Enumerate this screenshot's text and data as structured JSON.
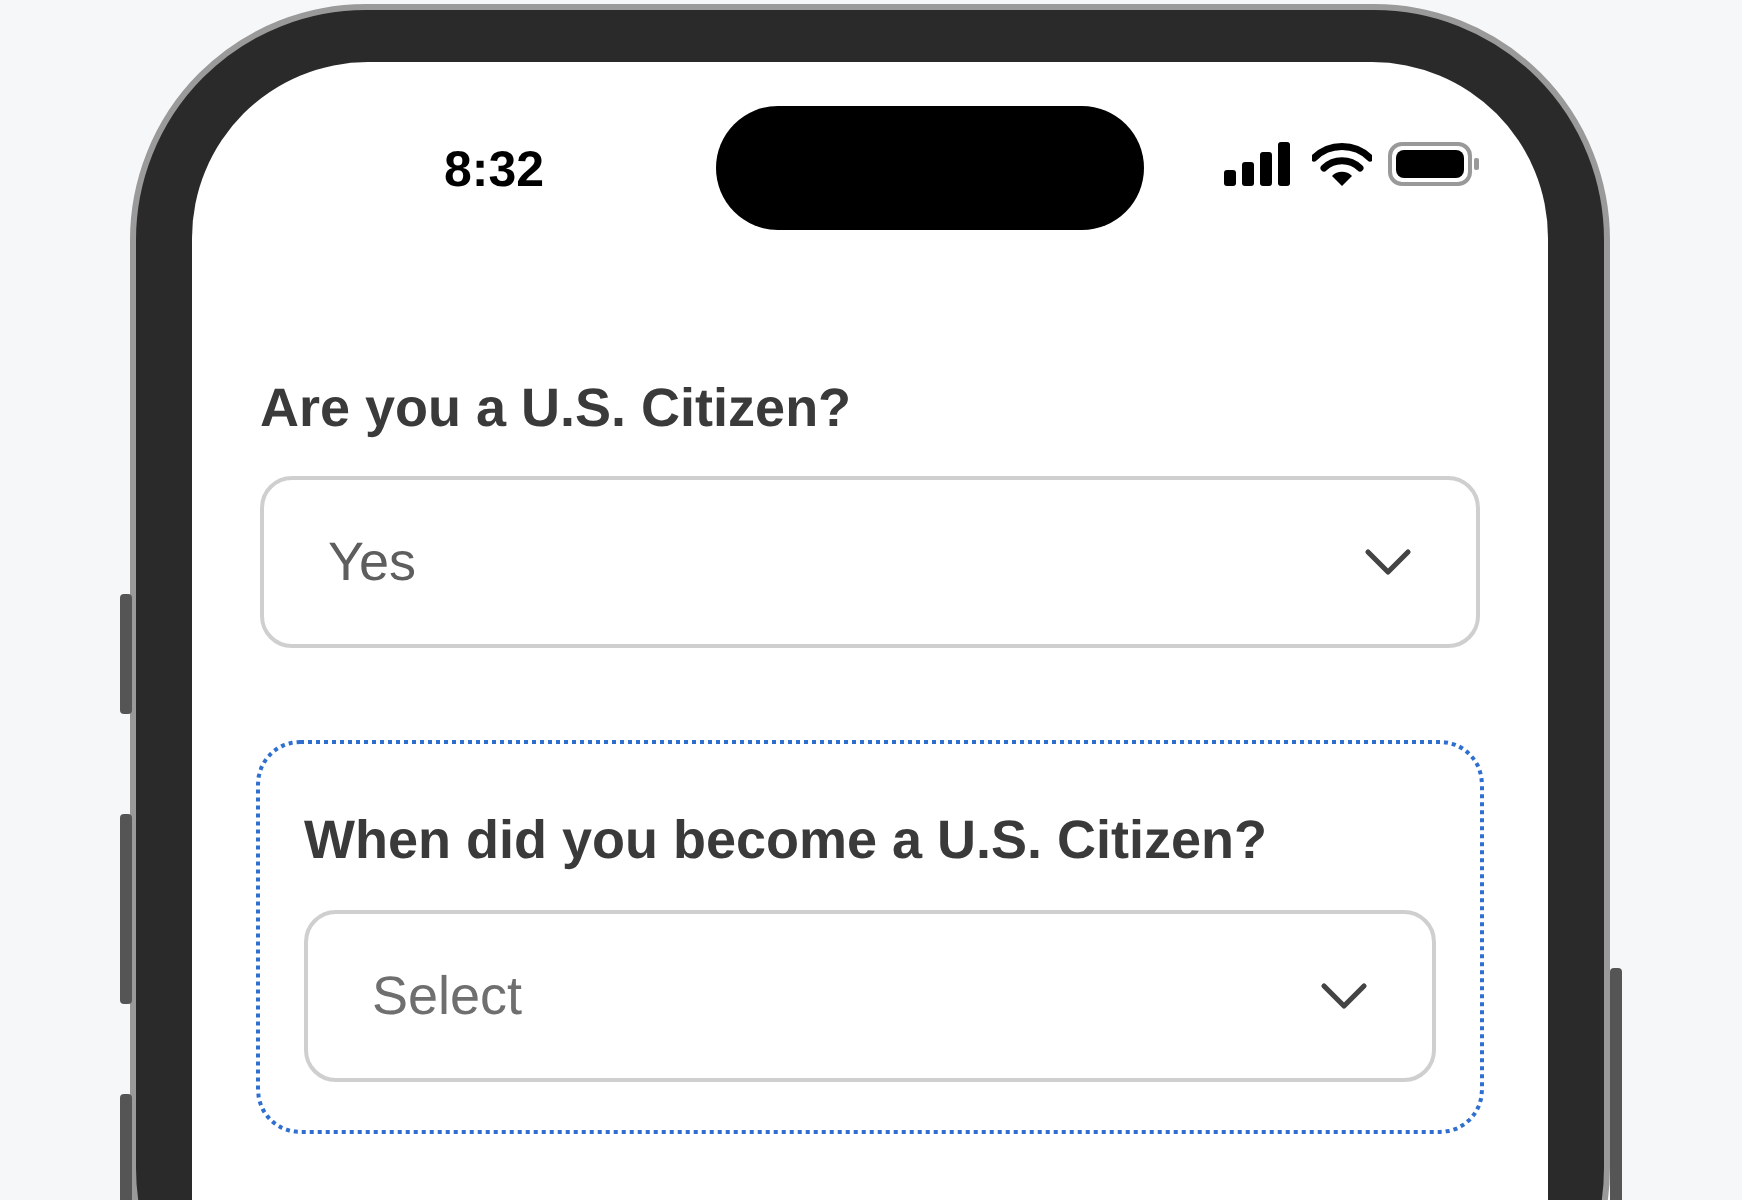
{
  "status_bar": {
    "time": "8:32"
  },
  "questions": [
    {
      "label": "Are you a U.S. Citizen?",
      "value": "Yes",
      "highlighted": false
    },
    {
      "label": "When did you become a U.S. Citizen?",
      "placeholder": "Select",
      "highlighted": true
    }
  ]
}
